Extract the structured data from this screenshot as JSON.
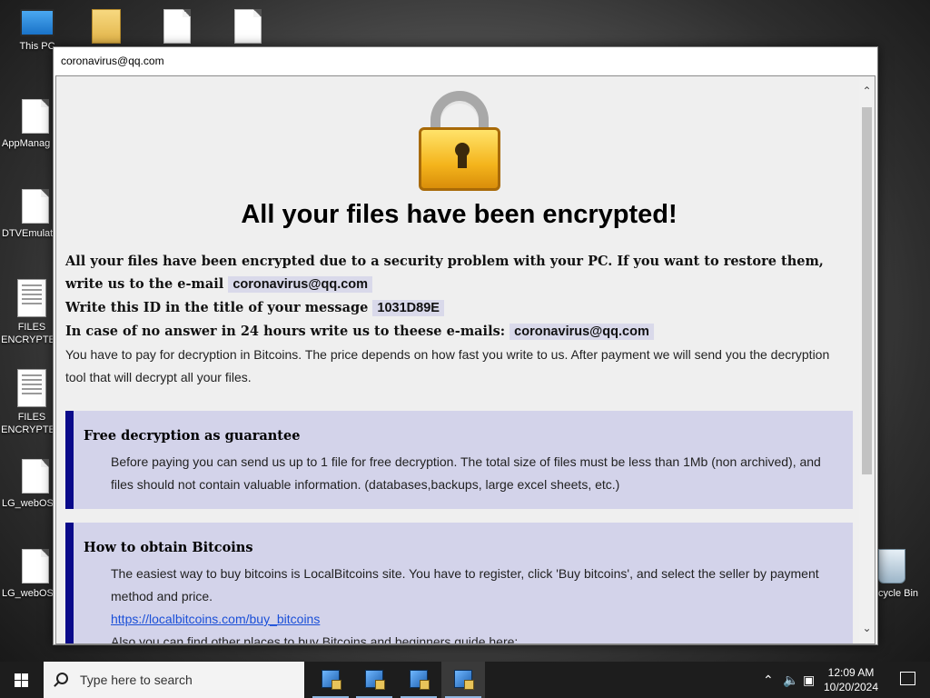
{
  "desktop": {
    "icons": [
      {
        "label": "This PC"
      },
      {
        "label": "AppManag"
      },
      {
        "label": "DTVEmulat"
      },
      {
        "label": "FILES ENCRYPTED"
      },
      {
        "label": "FILES ENCRYPTED"
      },
      {
        "label": "LG_webOS"
      },
      {
        "label": "LG_webOS"
      },
      {
        "label": "Recycle Bin"
      }
    ]
  },
  "window": {
    "title": "coronavirus@qq.com"
  },
  "note": {
    "icon": "padlock-icon",
    "headline": "All your files have been encrypted!",
    "line1_text": "All your files have been encrypted due to a security problem with your PC. If you want to restore them, write us to the e-mail",
    "email": "coronavirus@qq.com",
    "line2_text": "Write this ID in the title of your message",
    "id": "1031D89E",
    "line3_text": "In case of no answer in 24 hours write us to theese e-mails:",
    "email2": "coronavirus@qq.com",
    "line4_text": "You have to pay for decryption in Bitcoins. The price depends on how fast you write to us. After payment we will send you the decryption tool that will decrypt all your files.",
    "box1": {
      "title": "Free decryption as guarantee",
      "text": "Before paying you can send us up to 1 file for free decryption. The total size of files must be less than 1Mb (non archived), and files should not contain valuable information. (databases,backups, large excel sheets, etc.)"
    },
    "box2": {
      "title": "How to obtain Bitcoins",
      "text": "The easiest way to buy bitcoins is LocalBitcoins site. You have to register, click 'Buy bitcoins', and select the seller by payment method and price.",
      "link": "https://localbitcoins.com/buy_bitcoins",
      "text2": "Also you can find other places to buy Bitcoins and beginners guide here:"
    }
  },
  "taskbar": {
    "search_placeholder": "Type here to search",
    "time": "12:09 AM",
    "date": "10/20/2024",
    "apps": [
      "app-icon",
      "app-icon",
      "app-icon",
      "app-icon"
    ]
  },
  "colors": {
    "accent_box": "#d3d3ea",
    "box_border": "#0a0a8a",
    "highlight": "#d9d9ea"
  }
}
